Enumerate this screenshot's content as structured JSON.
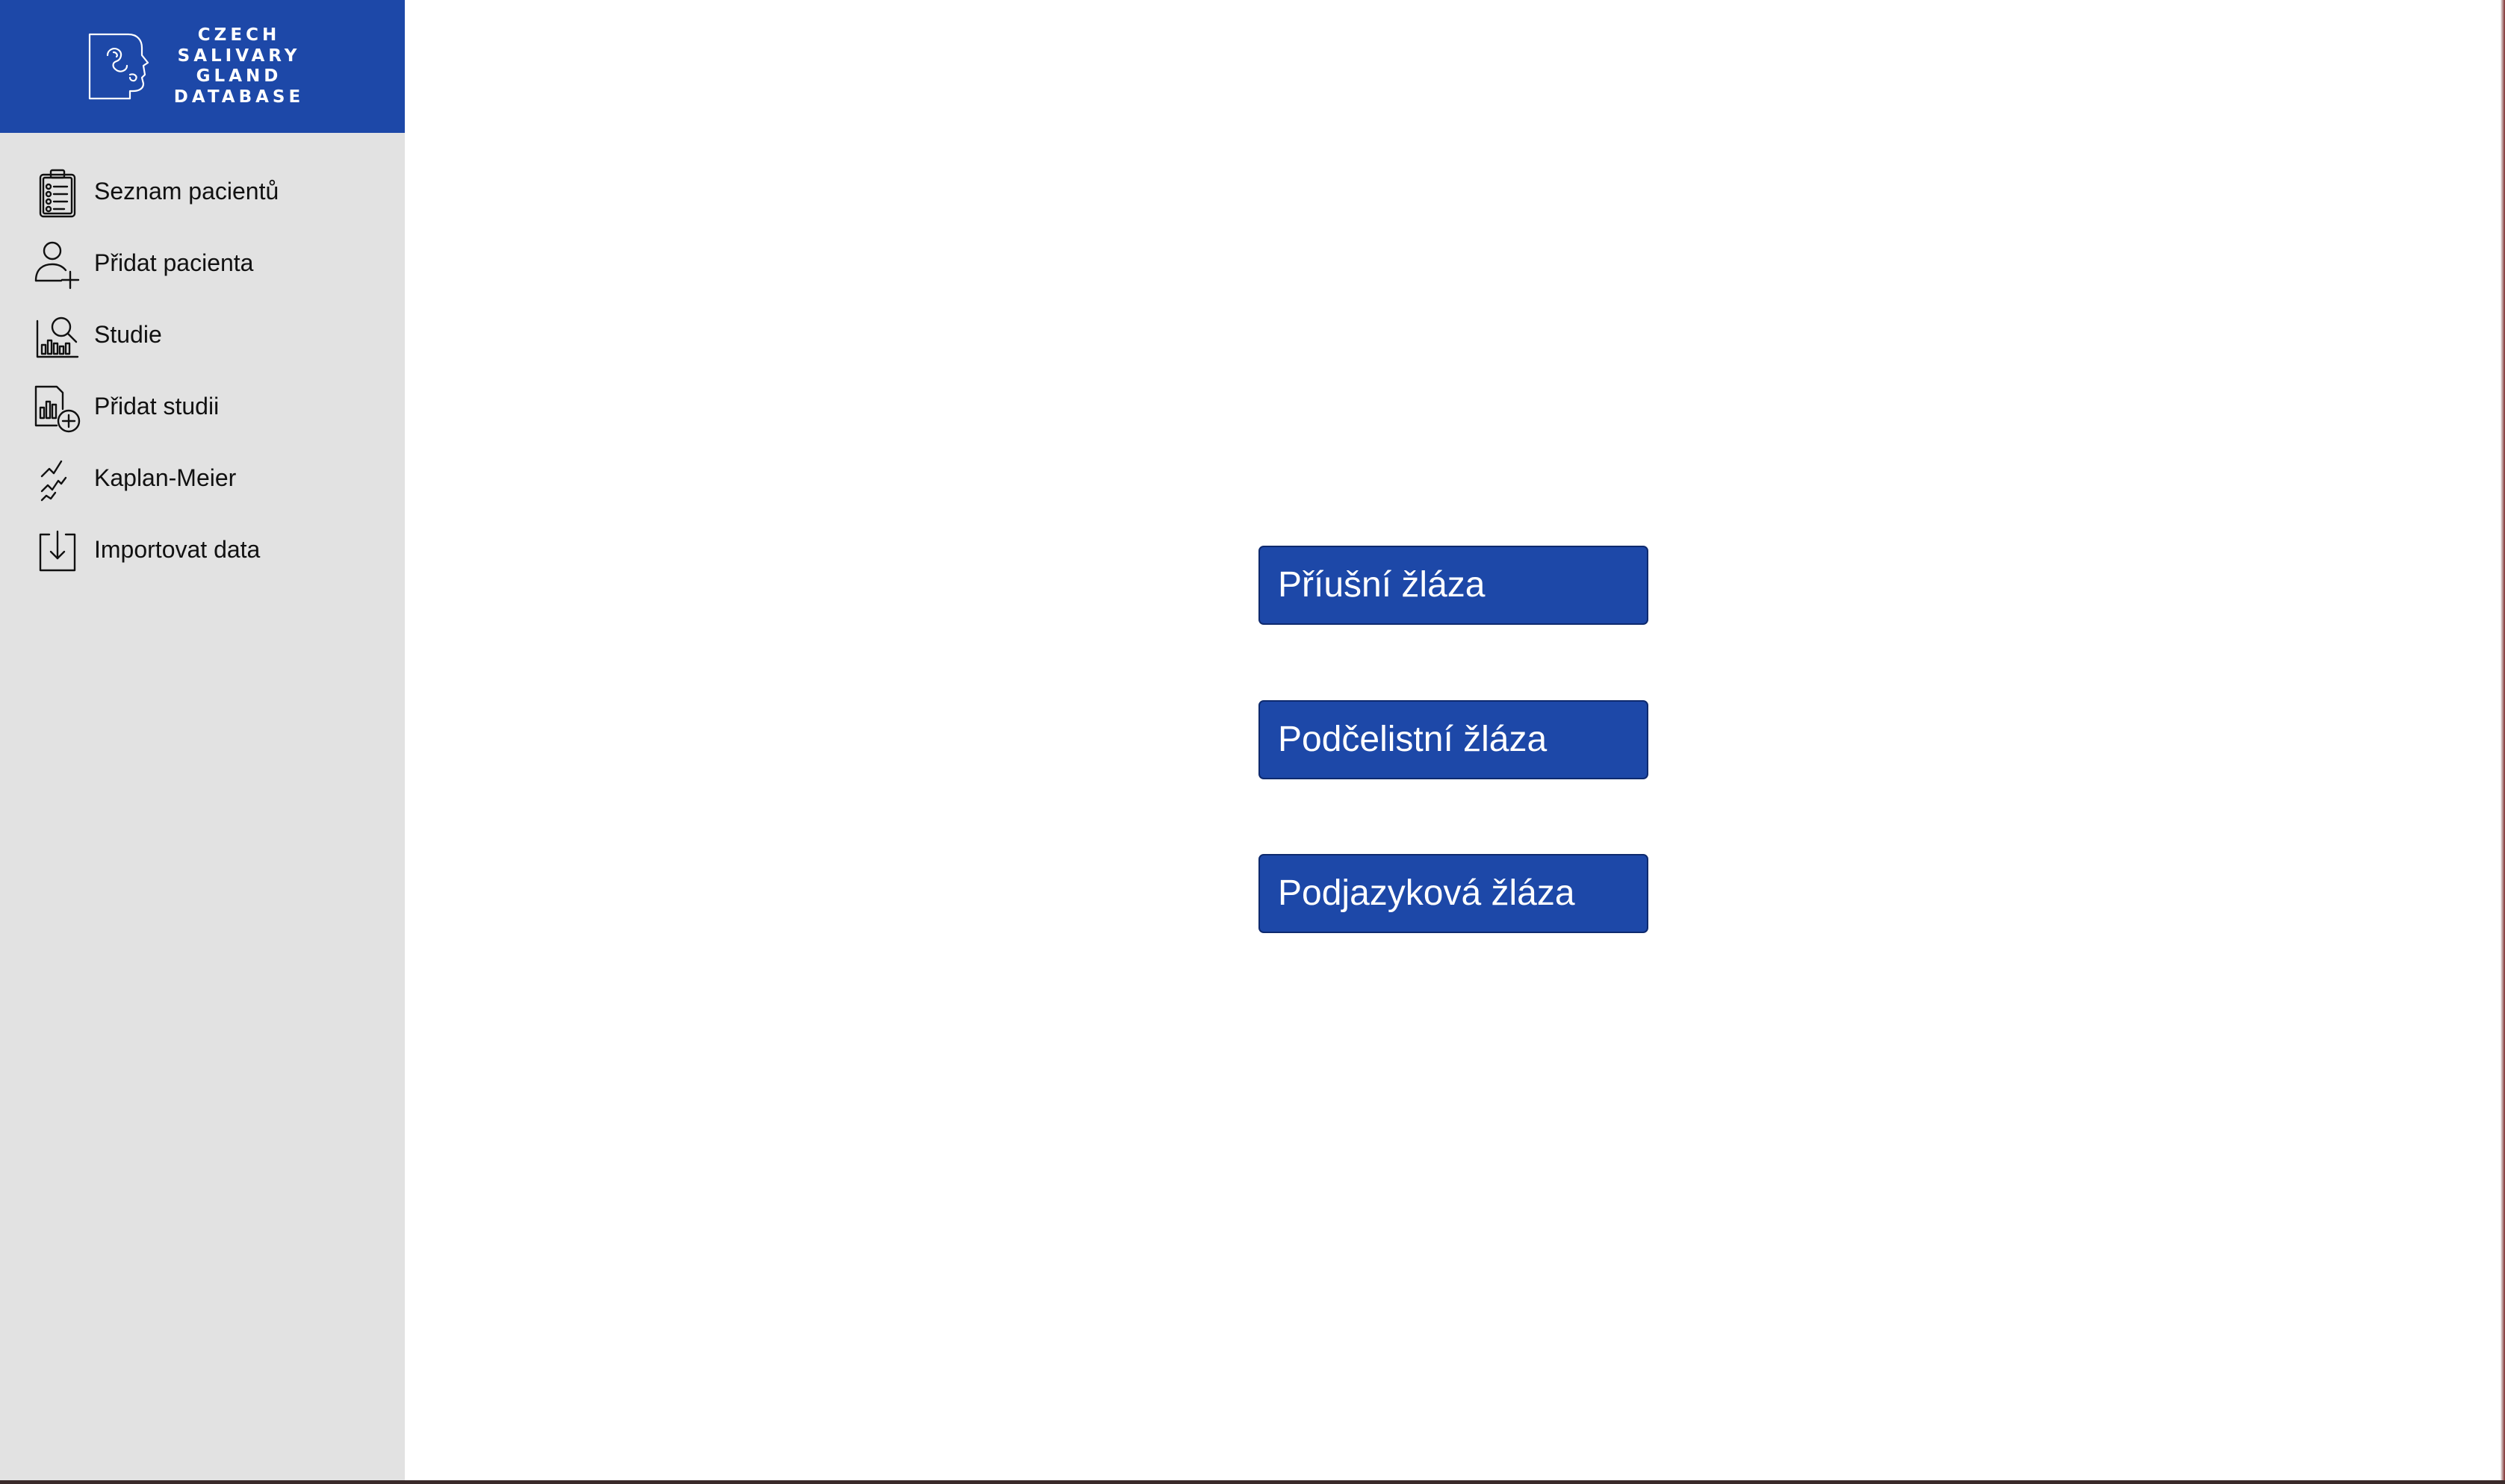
{
  "brand": {
    "lines": [
      "CZECH",
      "SALIVARY",
      "GLAND",
      "DATABASE"
    ],
    "logo_icon": "face-profile-icon",
    "color": "#1d48a8"
  },
  "sidebar": {
    "background": "#e2e2e2",
    "items": [
      {
        "label": "Seznam pacientů",
        "icon": "clipboard-list-icon"
      },
      {
        "label": "Přidat pacienta",
        "icon": "user-add-icon"
      },
      {
        "label": "Studie",
        "icon": "chart-search-icon"
      },
      {
        "label": "Přidat studii",
        "icon": "document-chart-add-icon"
      },
      {
        "label": "Kaplan-Meier",
        "icon": "line-trend-icon"
      },
      {
        "label": "Importovat data",
        "icon": "import-download-icon"
      }
    ]
  },
  "main": {
    "buttons": [
      {
        "label": "Příušní žláza"
      },
      {
        "label": "Podčelistní žláza"
      },
      {
        "label": "Podjazyková žláza"
      }
    ],
    "button_color": "#1d48a8"
  }
}
